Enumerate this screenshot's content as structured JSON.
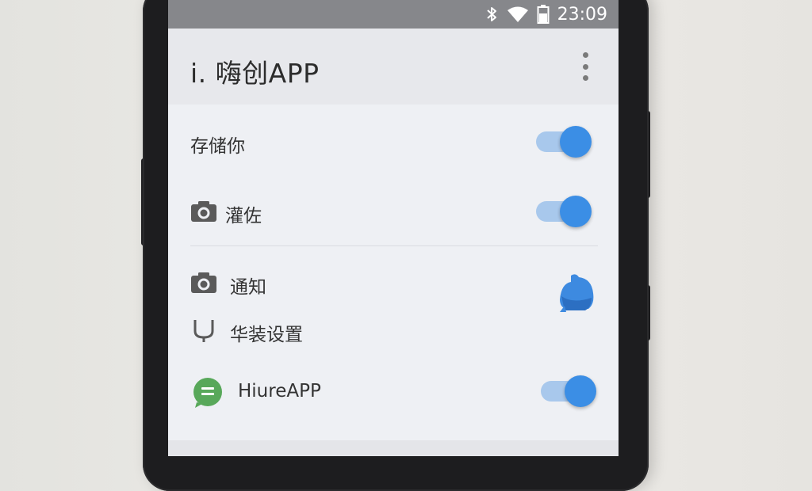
{
  "status_bar": {
    "time": "23:09",
    "icons": [
      "bluetooth-icon",
      "wifi-icon",
      "battery-icon"
    ]
  },
  "app_bar": {
    "title": "i. 嗨创APP",
    "menu_icon": "more-vertical-icon"
  },
  "settings": {
    "items": [
      {
        "label": "存储你",
        "icon": null,
        "control": "toggle",
        "on": true
      },
      {
        "label": "灌佐",
        "icon": "camera-icon",
        "control": "toggle",
        "on": true
      },
      {
        "label": "通知",
        "icon": "camera-icon",
        "control": "none"
      },
      {
        "label": "华装设置",
        "icon": "headset-icon",
        "control": "none"
      },
      {
        "label": "HiureAPP",
        "icon": "chat-app-icon",
        "control": "toggle",
        "on": true
      }
    ],
    "floating_icon": "bell-icon"
  },
  "colors": {
    "accent": "#3b8ee5",
    "track": "#a8c8ec",
    "status_bar": "#86878b",
    "app_bar": "#e7e8ec",
    "background": "#eef0f4",
    "chat_icon": "#58a85a"
  }
}
